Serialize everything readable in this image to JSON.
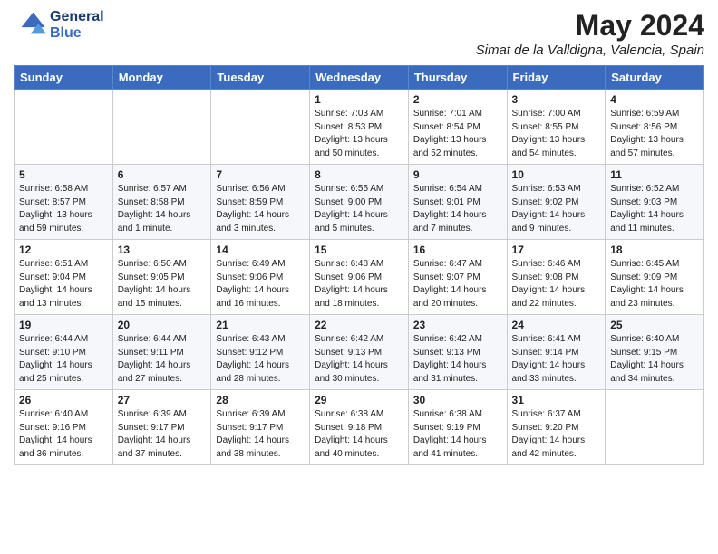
{
  "header": {
    "logo_line1": "General",
    "logo_line2": "Blue",
    "month": "May 2024",
    "location": "Simat de la Valldigna, Valencia, Spain"
  },
  "days_of_week": [
    "Sunday",
    "Monday",
    "Tuesday",
    "Wednesday",
    "Thursday",
    "Friday",
    "Saturday"
  ],
  "weeks": [
    [
      {
        "day": "",
        "info": ""
      },
      {
        "day": "",
        "info": ""
      },
      {
        "day": "",
        "info": ""
      },
      {
        "day": "1",
        "info": "Sunrise: 7:03 AM\nSunset: 8:53 PM\nDaylight: 13 hours\nand 50 minutes."
      },
      {
        "day": "2",
        "info": "Sunrise: 7:01 AM\nSunset: 8:54 PM\nDaylight: 13 hours\nand 52 minutes."
      },
      {
        "day": "3",
        "info": "Sunrise: 7:00 AM\nSunset: 8:55 PM\nDaylight: 13 hours\nand 54 minutes."
      },
      {
        "day": "4",
        "info": "Sunrise: 6:59 AM\nSunset: 8:56 PM\nDaylight: 13 hours\nand 57 minutes."
      }
    ],
    [
      {
        "day": "5",
        "info": "Sunrise: 6:58 AM\nSunset: 8:57 PM\nDaylight: 13 hours\nand 59 minutes."
      },
      {
        "day": "6",
        "info": "Sunrise: 6:57 AM\nSunset: 8:58 PM\nDaylight: 14 hours\nand 1 minute."
      },
      {
        "day": "7",
        "info": "Sunrise: 6:56 AM\nSunset: 8:59 PM\nDaylight: 14 hours\nand 3 minutes."
      },
      {
        "day": "8",
        "info": "Sunrise: 6:55 AM\nSunset: 9:00 PM\nDaylight: 14 hours\nand 5 minutes."
      },
      {
        "day": "9",
        "info": "Sunrise: 6:54 AM\nSunset: 9:01 PM\nDaylight: 14 hours\nand 7 minutes."
      },
      {
        "day": "10",
        "info": "Sunrise: 6:53 AM\nSunset: 9:02 PM\nDaylight: 14 hours\nand 9 minutes."
      },
      {
        "day": "11",
        "info": "Sunrise: 6:52 AM\nSunset: 9:03 PM\nDaylight: 14 hours\nand 11 minutes."
      }
    ],
    [
      {
        "day": "12",
        "info": "Sunrise: 6:51 AM\nSunset: 9:04 PM\nDaylight: 14 hours\nand 13 minutes."
      },
      {
        "day": "13",
        "info": "Sunrise: 6:50 AM\nSunset: 9:05 PM\nDaylight: 14 hours\nand 15 minutes."
      },
      {
        "day": "14",
        "info": "Sunrise: 6:49 AM\nSunset: 9:06 PM\nDaylight: 14 hours\nand 16 minutes."
      },
      {
        "day": "15",
        "info": "Sunrise: 6:48 AM\nSunset: 9:06 PM\nDaylight: 14 hours\nand 18 minutes."
      },
      {
        "day": "16",
        "info": "Sunrise: 6:47 AM\nSunset: 9:07 PM\nDaylight: 14 hours\nand 20 minutes."
      },
      {
        "day": "17",
        "info": "Sunrise: 6:46 AM\nSunset: 9:08 PM\nDaylight: 14 hours\nand 22 minutes."
      },
      {
        "day": "18",
        "info": "Sunrise: 6:45 AM\nSunset: 9:09 PM\nDaylight: 14 hours\nand 23 minutes."
      }
    ],
    [
      {
        "day": "19",
        "info": "Sunrise: 6:44 AM\nSunset: 9:10 PM\nDaylight: 14 hours\nand 25 minutes."
      },
      {
        "day": "20",
        "info": "Sunrise: 6:44 AM\nSunset: 9:11 PM\nDaylight: 14 hours\nand 27 minutes."
      },
      {
        "day": "21",
        "info": "Sunrise: 6:43 AM\nSunset: 9:12 PM\nDaylight: 14 hours\nand 28 minutes."
      },
      {
        "day": "22",
        "info": "Sunrise: 6:42 AM\nSunset: 9:13 PM\nDaylight: 14 hours\nand 30 minutes."
      },
      {
        "day": "23",
        "info": "Sunrise: 6:42 AM\nSunset: 9:13 PM\nDaylight: 14 hours\nand 31 minutes."
      },
      {
        "day": "24",
        "info": "Sunrise: 6:41 AM\nSunset: 9:14 PM\nDaylight: 14 hours\nand 33 minutes."
      },
      {
        "day": "25",
        "info": "Sunrise: 6:40 AM\nSunset: 9:15 PM\nDaylight: 14 hours\nand 34 minutes."
      }
    ],
    [
      {
        "day": "26",
        "info": "Sunrise: 6:40 AM\nSunset: 9:16 PM\nDaylight: 14 hours\nand 36 minutes."
      },
      {
        "day": "27",
        "info": "Sunrise: 6:39 AM\nSunset: 9:17 PM\nDaylight: 14 hours\nand 37 minutes."
      },
      {
        "day": "28",
        "info": "Sunrise: 6:39 AM\nSunset: 9:17 PM\nDaylight: 14 hours\nand 38 minutes."
      },
      {
        "day": "29",
        "info": "Sunrise: 6:38 AM\nSunset: 9:18 PM\nDaylight: 14 hours\nand 40 minutes."
      },
      {
        "day": "30",
        "info": "Sunrise: 6:38 AM\nSunset: 9:19 PM\nDaylight: 14 hours\nand 41 minutes."
      },
      {
        "day": "31",
        "info": "Sunrise: 6:37 AM\nSunset: 9:20 PM\nDaylight: 14 hours\nand 42 minutes."
      },
      {
        "day": "",
        "info": ""
      }
    ]
  ]
}
